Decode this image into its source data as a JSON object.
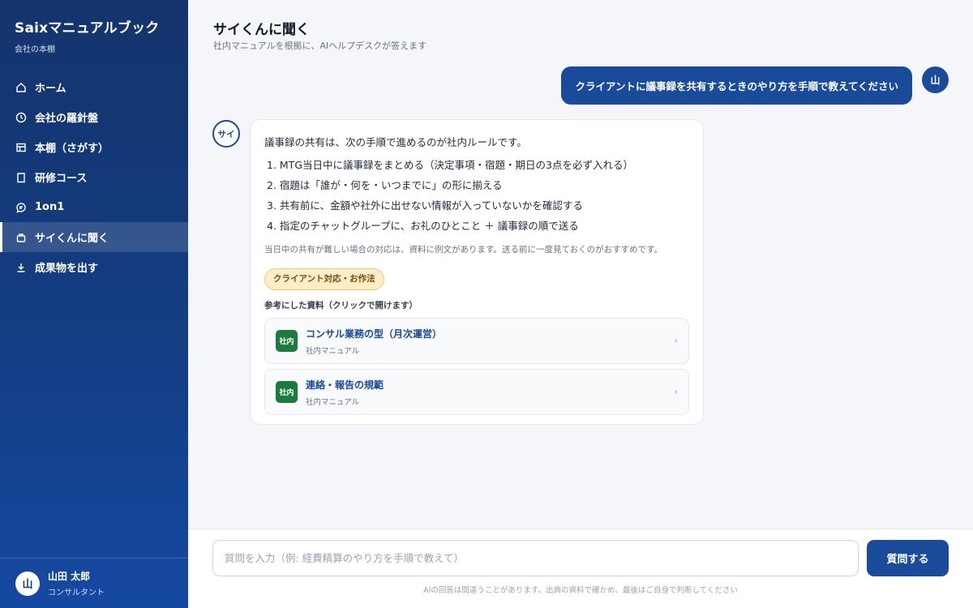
{
  "sidebar": {
    "brand_title": "Saixマニュアルブック",
    "brand_subtitle": "会社の本棚",
    "items": [
      {
        "label": "ホーム",
        "icon": "home-icon"
      },
      {
        "label": "会社の羅針盤",
        "icon": "compass-icon"
      },
      {
        "label": "本棚（さがす）",
        "icon": "bookshelf-icon"
      },
      {
        "label": "研修コース",
        "icon": "bookmark-icon"
      },
      {
        "label": "1on1",
        "icon": "chat-bubble-icon"
      },
      {
        "label": "サイくんに聞く",
        "icon": "robot-icon",
        "active": true
      },
      {
        "label": "成果物を出す",
        "icon": "download-icon"
      }
    ],
    "user": {
      "avatar": "山",
      "name": "山田 太郎",
      "role": "コンサルタント"
    }
  },
  "header": {
    "title": "サイくんに聞く",
    "subtitle": "社内マニュアルを根拠に、AIヘルプデスクが答えます"
  },
  "chat": {
    "user_message": "クライアントに議事録を共有するときのやり方を手順で教えてください",
    "user_avatar": "山",
    "ai_avatar": "サイ",
    "ai_intro": "議事録の共有は、次の手順で進めるのが社内ルールです。",
    "steps": [
      "1. MTG当日中に議事録をまとめる（決定事項・宿題・期日の3点を必ず入れる）",
      "2. 宿題は「誰が・何を・いつまでに」の形に揃える",
      "3. 共有前に、金額や社外に出せない情報が入っていないかを確認する",
      "4. 指定のチャットグループに、お礼のひとこと ＋ 議事録の順で送る"
    ],
    "note": "当日中の共有が難しい場合の対応は、資料に例文があります。送る前に一度見ておくのがおすすめです。",
    "tag": "クライアント対応・お作法",
    "refs_title": "参考にした資料（クリックで開けます）",
    "refs": [
      {
        "badge": "社内",
        "title": "コンサル業務の型（月次運営）",
        "subtitle": "社内マニュアル"
      },
      {
        "badge": "社内",
        "title": "連絡・報告の規範",
        "subtitle": "社内マニュアル"
      }
    ]
  },
  "composer": {
    "placeholder": "質問を入力（例: 経費精算のやり方を手順で教えて）",
    "button_label": "質問する",
    "disclaimer": "AIの回答は間違うことがあります。出典の資料で確かめ、最後はご自身で判断してください"
  },
  "colors": {
    "sidebar": "#143d83",
    "accent": "#1a4b9b",
    "tag_bg": "#fdeec8",
    "badge_green": "#1b7a3e"
  }
}
